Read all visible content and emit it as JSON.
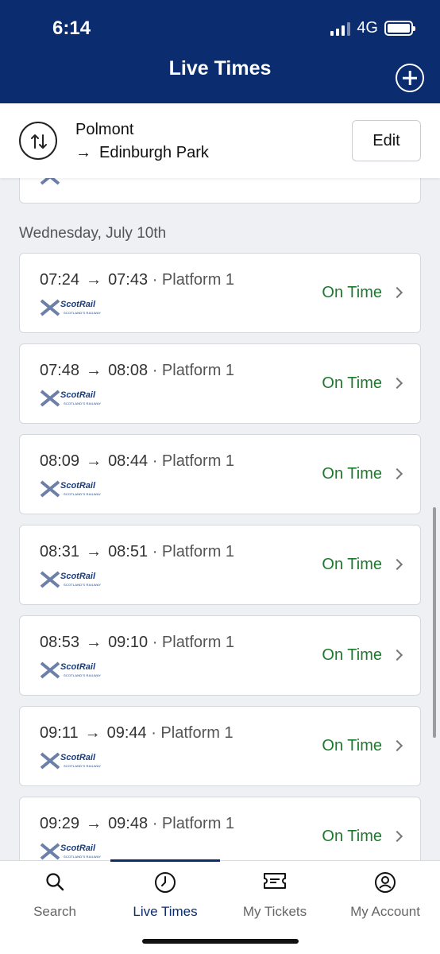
{
  "status_bar": {
    "time": "6:14",
    "network": "4G"
  },
  "header": {
    "title": "Live Times"
  },
  "route": {
    "from": "Polmont",
    "arrow": "→",
    "to": "Edinburgh Park",
    "edit_label": "Edit"
  },
  "date_heading": "Wednesday, July 10th",
  "logo": {
    "text": "ScotRail",
    "tagline": "SCOTLAND'S RAILWAY"
  },
  "journeys": [
    {
      "depart": "07:24",
      "arrow": "→",
      "arrive": "07:43",
      "platform": "· Platform 1",
      "status": "On Time"
    },
    {
      "depart": "07:48",
      "arrow": "→",
      "arrive": "08:08",
      "platform": "· Platform 1",
      "status": "On Time"
    },
    {
      "depart": "08:09",
      "arrow": "→",
      "arrive": "08:44",
      "platform": "· Platform 1",
      "status": "On Time"
    },
    {
      "depart": "08:31",
      "arrow": "→",
      "arrive": "08:51",
      "platform": "· Platform 1",
      "status": "On Time"
    },
    {
      "depart": "08:53",
      "arrow": "→",
      "arrive": "09:10",
      "platform": "· Platform 1",
      "status": "On Time"
    },
    {
      "depart": "09:11",
      "arrow": "→",
      "arrive": "09:44",
      "platform": "· Platform 1",
      "status": "On Time"
    },
    {
      "depart": "09:29",
      "arrow": "→",
      "arrive": "09:48",
      "platform": "· Platform 1",
      "status": "On Time"
    }
  ],
  "tabs": [
    {
      "label": "Search",
      "icon": "search-icon"
    },
    {
      "label": "Live Times",
      "icon": "clock-icon",
      "active": true
    },
    {
      "label": "My Tickets",
      "icon": "ticket-icon"
    },
    {
      "label": "My Account",
      "icon": "account-icon"
    }
  ],
  "colors": {
    "header": "#0b2d6f",
    "on_time": "#1c7a2c",
    "active_tab": "#0b2d6f"
  }
}
